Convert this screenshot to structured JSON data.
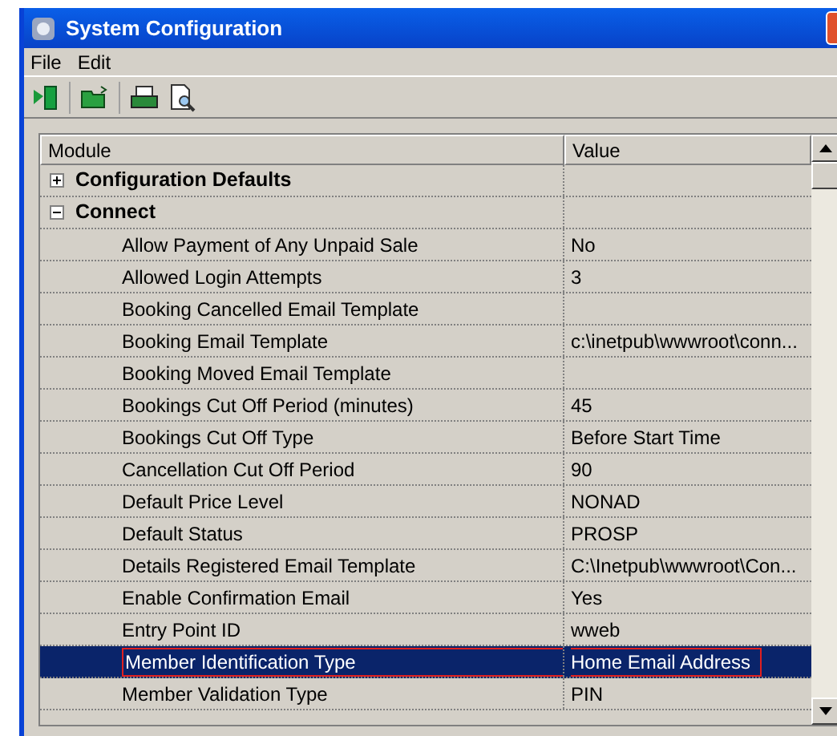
{
  "window": {
    "title": "System Configuration"
  },
  "menu": [
    "File",
    "Edit"
  ],
  "table": {
    "columns": [
      "Module",
      "Value"
    ],
    "groups": [
      {
        "name": "Configuration Defaults",
        "expanded": false
      },
      {
        "name": "Connect",
        "expanded": true,
        "children": [
          {
            "name": "Allow Payment of Any Unpaid Sale",
            "value": "No",
            "selected": false
          },
          {
            "name": "Allowed Login Attempts",
            "value": "3",
            "selected": false
          },
          {
            "name": "Booking Cancelled Email Template",
            "selected": false
          },
          {
            "name": "Booking Email Template",
            "value": "c:\\inetpub\\wwwroot\\conn...",
            "selected": false
          },
          {
            "name": "Booking Moved Email Template",
            "selected": false
          },
          {
            "name": "Bookings Cut Off Period (minutes)",
            "value": "45",
            "selected": false
          },
          {
            "name": "Bookings Cut Off Type",
            "value": "Before Start Time",
            "selected": false
          },
          {
            "name": "Cancellation Cut Off Period",
            "value": "90",
            "selected": false
          },
          {
            "name": "Default Price Level",
            "value": "NONAD",
            "selected": false
          },
          {
            "name": "Default Status",
            "value": "PROSP",
            "selected": false
          },
          {
            "name": "Details Registered Email Template",
            "value": "C:\\Inetpub\\wwwroot\\Con...",
            "selected": false
          },
          {
            "name": "Enable Confirmation Email",
            "value": "Yes",
            "selected": false
          },
          {
            "name": "Entry Point ID",
            "value": "wweb",
            "selected": false
          },
          {
            "name": "Member Identification Type",
            "value": "Home Email Address",
            "selected": true
          },
          {
            "name": "Member Validation Type",
            "value": "PIN",
            "selected": false
          }
        ]
      }
    ]
  }
}
